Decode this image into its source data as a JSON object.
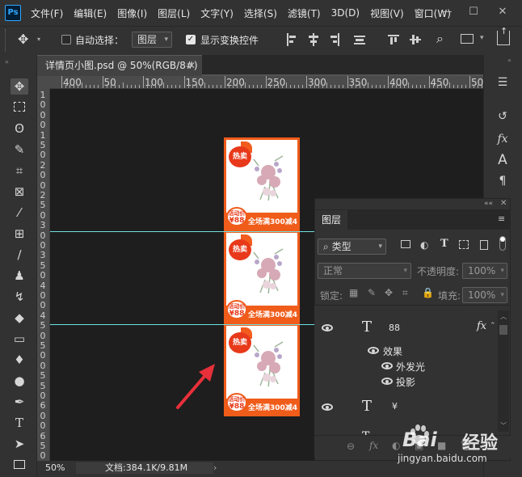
{
  "menubar": {
    "logo": "Ps",
    "items": [
      "文件(F)",
      "编辑(E)",
      "图像(I)",
      "图层(L)",
      "文字(Y)",
      "选择(S)",
      "滤镜(T)",
      "3D(D)",
      "视图(V)",
      "窗口(W)"
    ],
    "window_controls": [
      "—",
      "☐",
      "✕"
    ]
  },
  "options": {
    "auto_select_label": "自动选择：",
    "auto_select_checked": false,
    "auto_select_target": "图层",
    "show_transform_label": "显示变换控件",
    "show_transform_checked": true
  },
  "document": {
    "tab_title": "详情页小图.psd @ 50%(RGB/8#)",
    "zoom": "50%",
    "doc_size": "文档:384.1K/9.81M",
    "ruler_top": [
      "400",
      "350",
      "300",
      "250",
      "200",
      "150",
      "100",
      "50",
      "0",
      "50",
      "100",
      "150",
      "200",
      "250",
      "300",
      "350",
      "400",
      "450",
      "500",
      "550",
      "600"
    ],
    "ruler_left": [
      "1",
      "0",
      "0",
      "0",
      "1",
      "5",
      "0",
      "2",
      "0",
      "0",
      "2",
      "5",
      "0",
      "3",
      "0",
      "0",
      "3",
      "5",
      "0",
      "4",
      "0",
      "0",
      "4",
      "5",
      "0",
      "5",
      "0",
      "0",
      "5",
      "5",
      "0",
      "6",
      "0",
      "0",
      "6",
      "5",
      "0"
    ]
  },
  "products": [
    {
      "hot": "热卖",
      "badge_top": "活动价",
      "badge_price": "88",
      "promo": "全场满300减40"
    },
    {
      "hot": "热卖",
      "badge_top": "活动价",
      "badge_price": "88",
      "promo": "全场满300减40"
    },
    {
      "hot": "热卖",
      "badge_top": "活动价",
      "badge_price": "88",
      "promo": "全场满300减40"
    }
  ],
  "layers_panel": {
    "tab": "图层",
    "filter_kind": "类型",
    "blend_mode": "正常",
    "opacity_label": "不透明度:",
    "opacity_value": "100%",
    "lock_label": "锁定:",
    "fill_label": "填充:",
    "fill_value": "100%",
    "layers": [
      {
        "type": "T",
        "name": "88",
        "fx": "fx"
      },
      {
        "type": "T",
        "name": "¥",
        "fx": ""
      }
    ],
    "effects_label": "效果",
    "effects": [
      "外发光",
      "投影"
    ],
    "footer": [
      "⊖",
      "fx",
      "◐",
      "▣",
      "■",
      "🗑"
    ]
  },
  "watermark": {
    "main": "Bai",
    "sub": "经验",
    "url": "jingyan.baidu.com"
  },
  "colors": {
    "accent": "#f05c1a",
    "guide": "#6ee1e1",
    "canvas": "#1e1e1e"
  }
}
